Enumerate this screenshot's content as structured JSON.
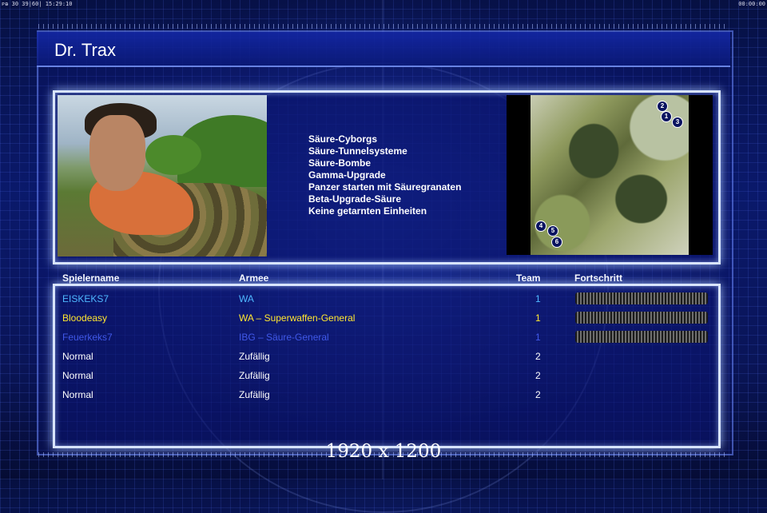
{
  "topbar": {
    "left": "ᴘᴃ 30 39|60| 15:29:10",
    "right": "00:00:00"
  },
  "title": "Dr. Trax",
  "perks": [
    "Säure-Cyborgs",
    "Säure-Tunnelsysteme",
    "Säure-Bombe",
    "Gamma-Upgrade",
    "Panzer starten mit Säuregranaten",
    "Beta-Upgrade-Säure",
    "Keine getarnten Einheiten"
  ],
  "map": {
    "start_positions": [
      "1",
      "2",
      "3",
      "4",
      "5",
      "6"
    ]
  },
  "table": {
    "headers": {
      "name": "Spielername",
      "army": "Armee",
      "team": "Team",
      "progress": "Fortschritt"
    },
    "rows": [
      {
        "name": "EISKEKS7",
        "army": "WA",
        "team": "1",
        "color": "#4fb8ff",
        "progress": 1.0
      },
      {
        "name": "Bloodeasy",
        "army": "WA – Superwaffen-General",
        "team": "1",
        "color": "#ffe630",
        "progress": 1.0
      },
      {
        "name": "Feuerkeks7",
        "army": "IBG – Säure-General",
        "team": "1",
        "color": "#4058e8",
        "progress": 1.0
      },
      {
        "name": "Normal",
        "army": "Zufällig",
        "team": "2",
        "color": "#ffffff"
      },
      {
        "name": "Normal",
        "army": "Zufällig",
        "team": "2",
        "color": "#ffffff"
      },
      {
        "name": "Normal",
        "army": "Zufällig",
        "team": "2",
        "color": "#ffffff"
      }
    ]
  },
  "resolution": "1920 x 1200"
}
